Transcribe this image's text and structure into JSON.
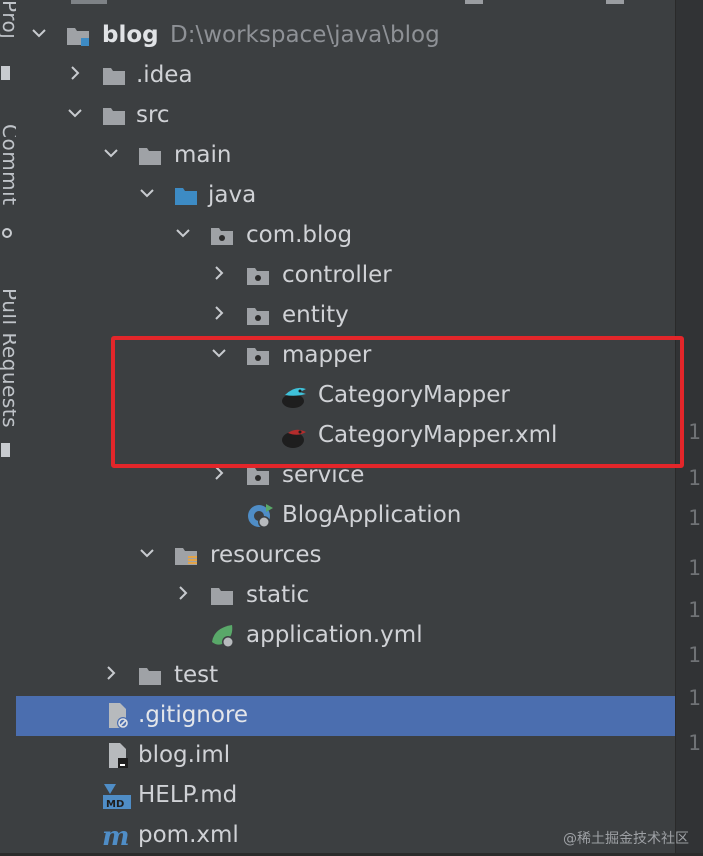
{
  "sidebar": {
    "project_tab": "Proj",
    "commit_tab": "Commit",
    "pull_requests_tab": "Pull Requests"
  },
  "tree": {
    "items": [
      {
        "label": "blog",
        "path": "D:\\workspace\\java\\blog",
        "icon": "module-folder-icon",
        "expanded": true
      },
      {
        "label": ".idea",
        "icon": "folder-icon",
        "expanded": false
      },
      {
        "label": "src",
        "icon": "folder-icon",
        "expanded": true
      },
      {
        "label": "main",
        "icon": "folder-icon",
        "expanded": true
      },
      {
        "label": "java",
        "icon": "source-folder-icon",
        "expanded": true
      },
      {
        "label": "com.blog",
        "icon": "package-icon",
        "expanded": true
      },
      {
        "label": "controller",
        "icon": "package-icon",
        "expanded": false
      },
      {
        "label": "entity",
        "icon": "package-icon",
        "expanded": false
      },
      {
        "label": "mapper",
        "icon": "package-icon",
        "expanded": true
      },
      {
        "label": "CategoryMapper",
        "icon": "mybatis-mapper-interface-icon"
      },
      {
        "label": "CategoryMapper.xml",
        "icon": "mybatis-mapper-xml-icon"
      },
      {
        "label": "service",
        "icon": "package-icon",
        "expanded": false
      },
      {
        "label": "BlogApplication",
        "icon": "spring-boot-application-icon"
      },
      {
        "label": "resources",
        "icon": "resources-folder-icon",
        "expanded": true
      },
      {
        "label": "static",
        "icon": "folder-icon",
        "expanded": false
      },
      {
        "label": "application.yml",
        "icon": "spring-config-icon"
      },
      {
        "label": "test",
        "icon": "folder-icon",
        "expanded": false
      },
      {
        "label": ".gitignore",
        "icon": "ignored-file-icon",
        "selected": true
      },
      {
        "label": "blog.iml",
        "icon": "iml-file-icon"
      },
      {
        "label": "HELP.md",
        "icon": "markdown-file-icon"
      },
      {
        "label": "pom.xml",
        "icon": "maven-pom-icon"
      }
    ]
  },
  "gutter": {
    "line_numbers": [
      "1",
      "1",
      "1",
      "1",
      "1",
      "1",
      "1",
      "1"
    ]
  },
  "watermark": "@稀土掘金技术社区",
  "colors": {
    "panel_bg": "#3c3f41",
    "selection": "#4b6eaf",
    "highlight_border": "#e3262a",
    "folder": "#9fa2a6",
    "source_folder": "#3d8bc4"
  }
}
